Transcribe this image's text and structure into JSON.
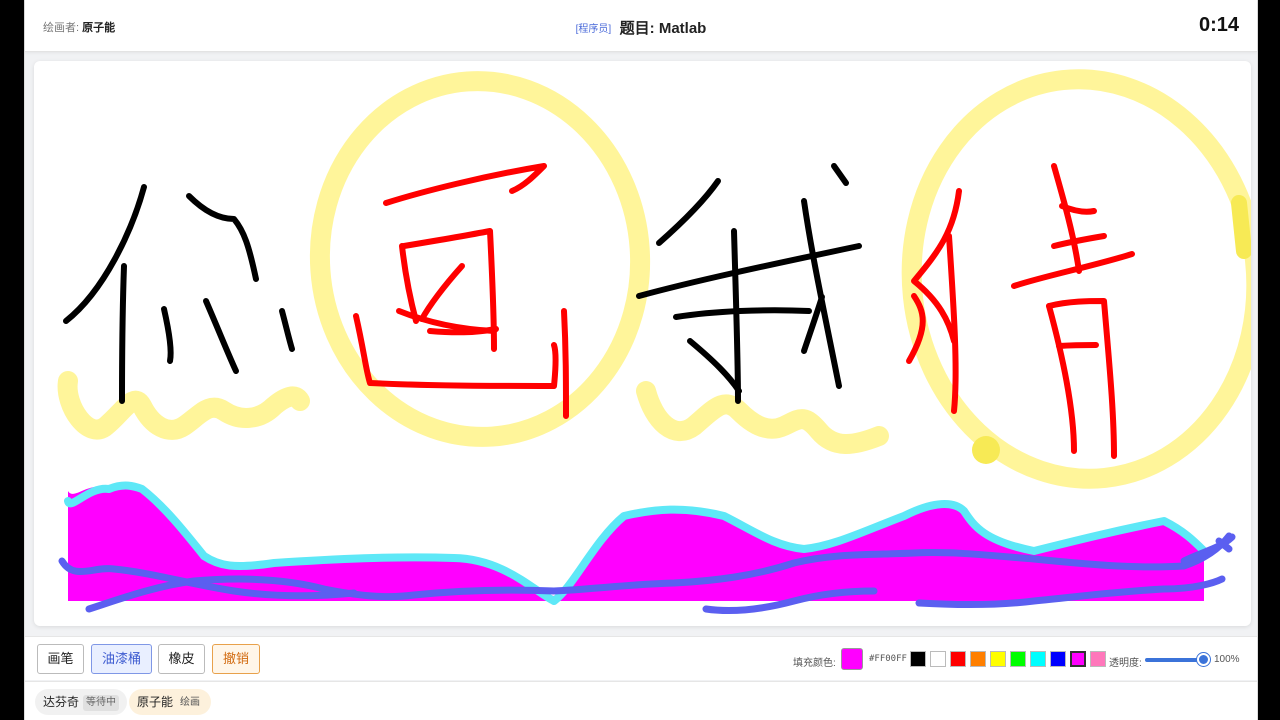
{
  "header": {
    "drawer_label": "绘画者:",
    "drawer_name": "原子能",
    "role": "[程序员]",
    "topic": "题目: Matlab",
    "timer": "0:14"
  },
  "toolbar": {
    "brush": "画笔",
    "bucket": "油漆桶",
    "eraser": "橡皮",
    "undo": "撤销",
    "fill_label": "填充颜色:",
    "fill_color": "#FF00FF",
    "fill_hex": "#FF00FF",
    "palette": [
      "#000000",
      "#FFFFFF",
      "#FF0000",
      "#FF7F00",
      "#FFFF00",
      "#00FF00",
      "#00FFFF",
      "#0000FF",
      "#FF00FF",
      "#FF77BB"
    ],
    "opacity_label": "透明度:",
    "opacity_value": "100%"
  },
  "players": [
    {
      "name": "达芬奇",
      "status": "等待中"
    },
    {
      "name": "原子能",
      "status": "绘画"
    }
  ],
  "colors": {
    "highlight": "#fff59a",
    "red_ink": "#ff0000",
    "black_ink": "#000000",
    "fill": "#ff00ff",
    "cyan_outline": "#5ee8f7",
    "blue_ink": "#5b5ff0"
  }
}
